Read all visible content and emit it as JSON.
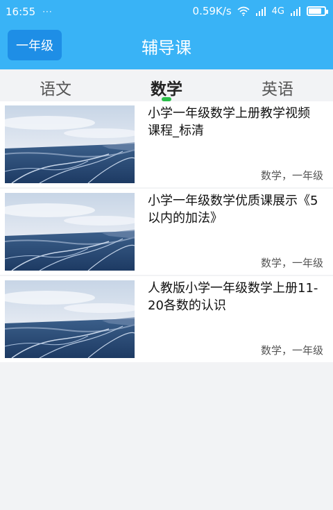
{
  "status": {
    "time": "16:55",
    "dots": "···",
    "speed": "0.59K/s",
    "network": "4G",
    "battery_level": 0.8
  },
  "header": {
    "grade_button": "一年级",
    "title": "辅导课"
  },
  "tabs": [
    {
      "label": "语文",
      "active": false
    },
    {
      "label": "数学",
      "active": true
    },
    {
      "label": "英语",
      "active": false
    }
  ],
  "courses": [
    {
      "title": "小学一年级数学上册教学视频课程_标清",
      "meta": "数学，一年级"
    },
    {
      "title": "小学一年级数学优质课展示《5以内的加法》",
      "meta": "数学，一年级"
    },
    {
      "title": "人教版小学一年级数学上册11-20各数的认识",
      "meta": "数学，一年级"
    }
  ]
}
